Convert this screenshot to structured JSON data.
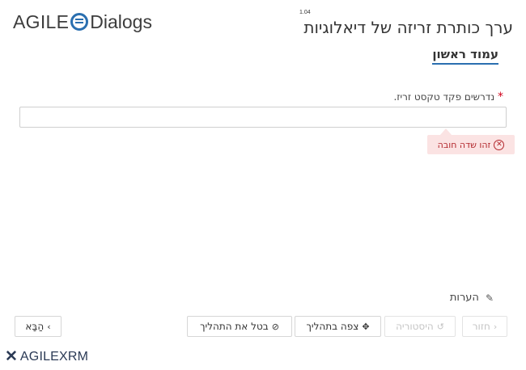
{
  "brand": {
    "logo_left": "AGILE",
    "logo_right": "Dialogs",
    "bottom_logo": "AGILEXRM",
    "accent": "#2a6fb0"
  },
  "header": {
    "version": "1.04",
    "title": "ערך כותרת זריזה של דיאלוגיות"
  },
  "page": {
    "tab": "עמוד ראשון"
  },
  "field": {
    "label": "נדרשים  פקד טקסט זריז.",
    "required_mark": "*",
    "value": "",
    "error": "זהו שדה חובה"
  },
  "comments": {
    "label": "הערות"
  },
  "buttons": {
    "back": "חזור",
    "history": "היסטוריה",
    "view_process": "צפה בתהליך",
    "cancel_process": "בטל את התהליך",
    "next": "הַבָּא"
  },
  "colors": {
    "error_bg": "#fbe3e3",
    "error_text": "#b3282d"
  }
}
